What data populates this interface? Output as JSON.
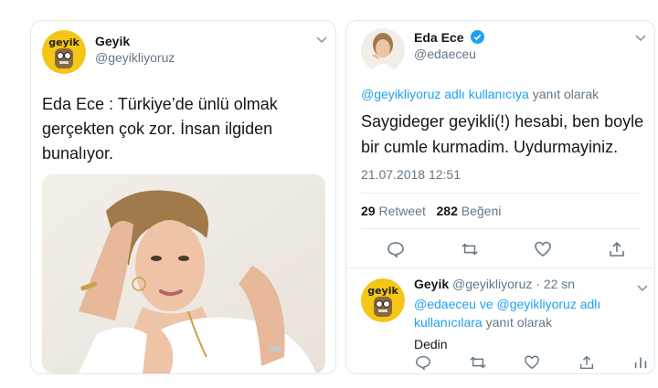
{
  "left_tweet": {
    "author_name": "Geyik",
    "author_handle": "@geyikliyoruz",
    "text_line1": "Eda Ece : Türkiye’de ünlü olmak",
    "text_line2": "gerçekten çok zor. İnsan ilgiden",
    "text_line3": "bunalıyor."
  },
  "right_tweet": {
    "author_name": "Eda Ece",
    "author_handle": "@edaeceu",
    "reply_handle": "@geyikliyoruz adlı kullanıcıya",
    "reply_suffix": "yanıt olarak",
    "text_line1": "Saygideger geyikli(!) hesabi, ben boyle",
    "text_line2": "bir cumle kurmadim. Uydurmayiniz.",
    "timestamp": "21.07.2018 12:51",
    "retweet_count": "29",
    "retweet_label": "Retweet",
    "like_count": "282",
    "like_label": "Beğeni"
  },
  "reply_tweet": {
    "author_name": "Geyik",
    "author_handle": "@geyikliyoruz",
    "time": "· 22 sn",
    "reply_handles_line1": "@edaeceu ve @geyikliyoruz adlı",
    "reply_handles_line2": "kullanıcılara",
    "reply_suffix": "yanıt olarak",
    "text": "Dedin"
  },
  "colors": {
    "link": "#1da1f2",
    "muted": "#657786",
    "text": "#14171a",
    "avatar_bg": "#f5c518"
  },
  "icons": {
    "chevron": "chevron-down-icon",
    "verified": "verified-badge-icon",
    "reply": "reply-icon",
    "retweet": "retweet-icon",
    "like": "heart-icon",
    "share": "share-icon",
    "analytics": "analytics-icon"
  }
}
